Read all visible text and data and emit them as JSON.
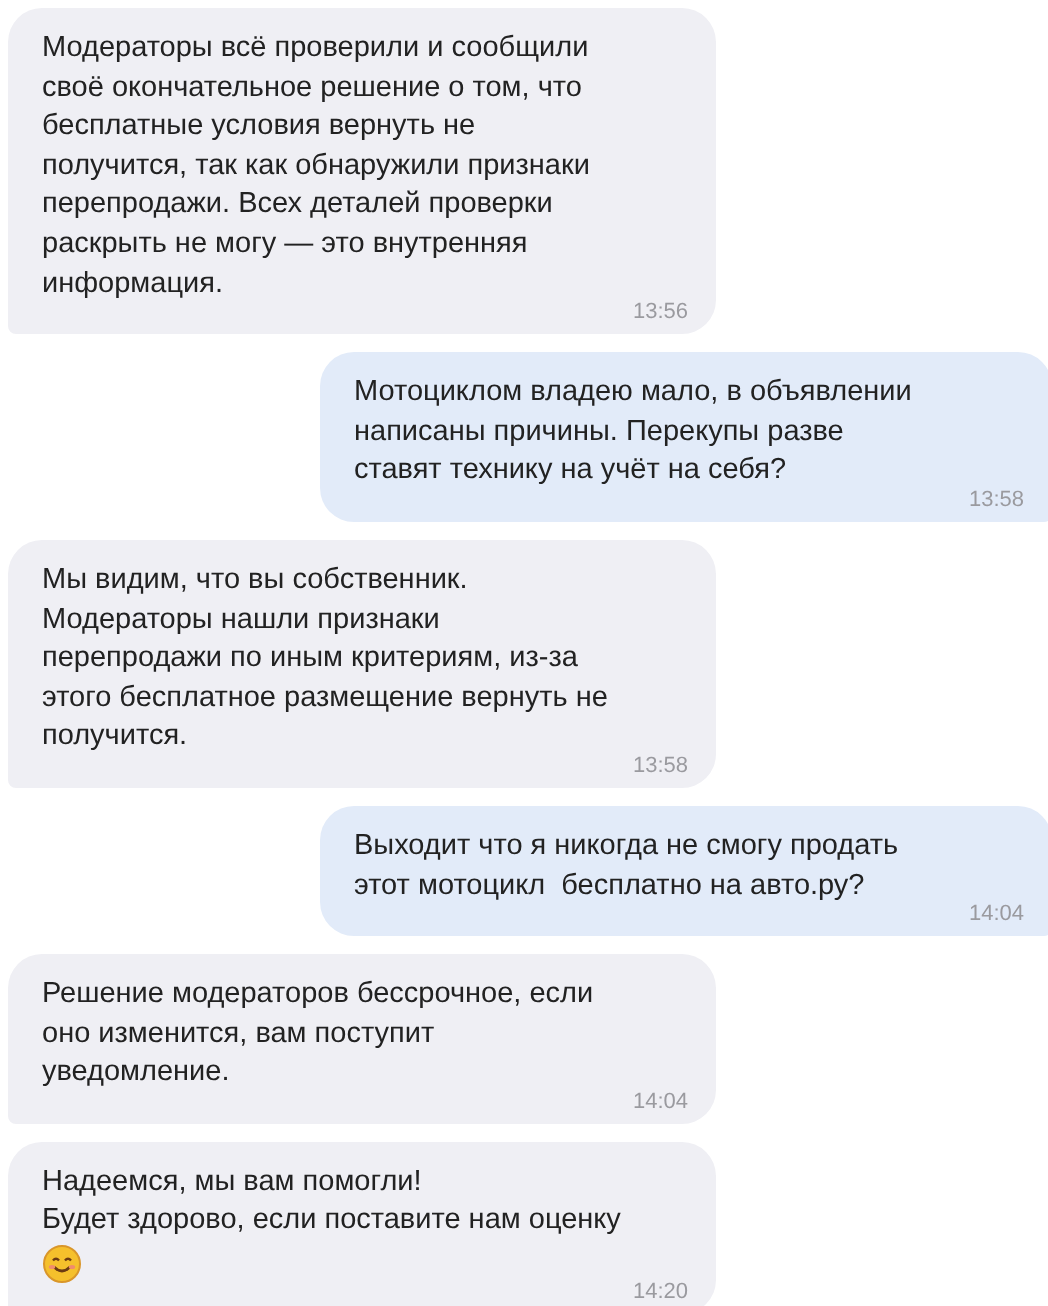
{
  "messages": [
    {
      "kind": "incoming",
      "text": "Модераторы всё проверили и сообщили\nсвоё окончательное решение о том, что\nбесплатные условия вернуть не\nполучится, так как обнаружили признаки\nперепродажи. Всех деталей проверки\nраскрыть не могу — это внутренняя\nинформация.",
      "time": "13:56"
    },
    {
      "kind": "outgoing",
      "text": "Мотоциклом владею мало, в объявлении\nнаписаны причины. Перекупы разве\nставят технику на учёт на себя?",
      "time": "13:58"
    },
    {
      "kind": "incoming",
      "text": "Мы видим, что вы собственник.\nМодераторы нашли признаки\nперепродажи по иным критериям, из-за\nэтого бесплатное размещение вернуть не\nполучится.",
      "time": "13:58"
    },
    {
      "kind": "outgoing",
      "text": "Выходит что я никогда не смогу продать\nэтот мотоцикл  бесплатно на авто.ру?",
      "time": "14:04"
    },
    {
      "kind": "incoming",
      "text": "Решение модераторов бессрочное, если\nоно изменится, вам поступит\nуведомление.",
      "time": "14:04"
    },
    {
      "kind": "incoming",
      "text": "Надеемся, мы вам помогли!\nБудет здорово, если поставите нам оценку",
      "time": "14:20",
      "emoji": {
        "kind": "smile"
      }
    }
  ]
}
